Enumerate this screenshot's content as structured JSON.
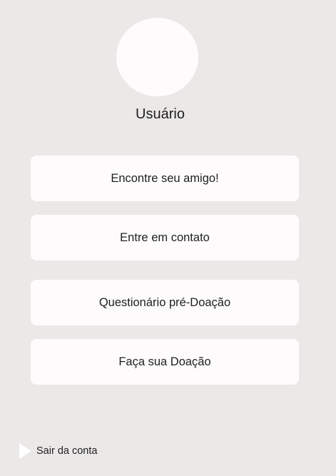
{
  "profile": {
    "username": "Usuário"
  },
  "menu": {
    "items": [
      {
        "label": "Encontre seu amigo!"
      },
      {
        "label": "Entre em contato"
      },
      {
        "label": "Questionário pré-Doação"
      },
      {
        "label": "Faça sua Doação"
      }
    ]
  },
  "footer": {
    "logout_label": "Sair da conta",
    "logout_icon": "play-triangle-icon"
  },
  "colors": {
    "background": "#ebe8e8",
    "card": "#fdfbfc",
    "text": "#1f1f1f"
  }
}
